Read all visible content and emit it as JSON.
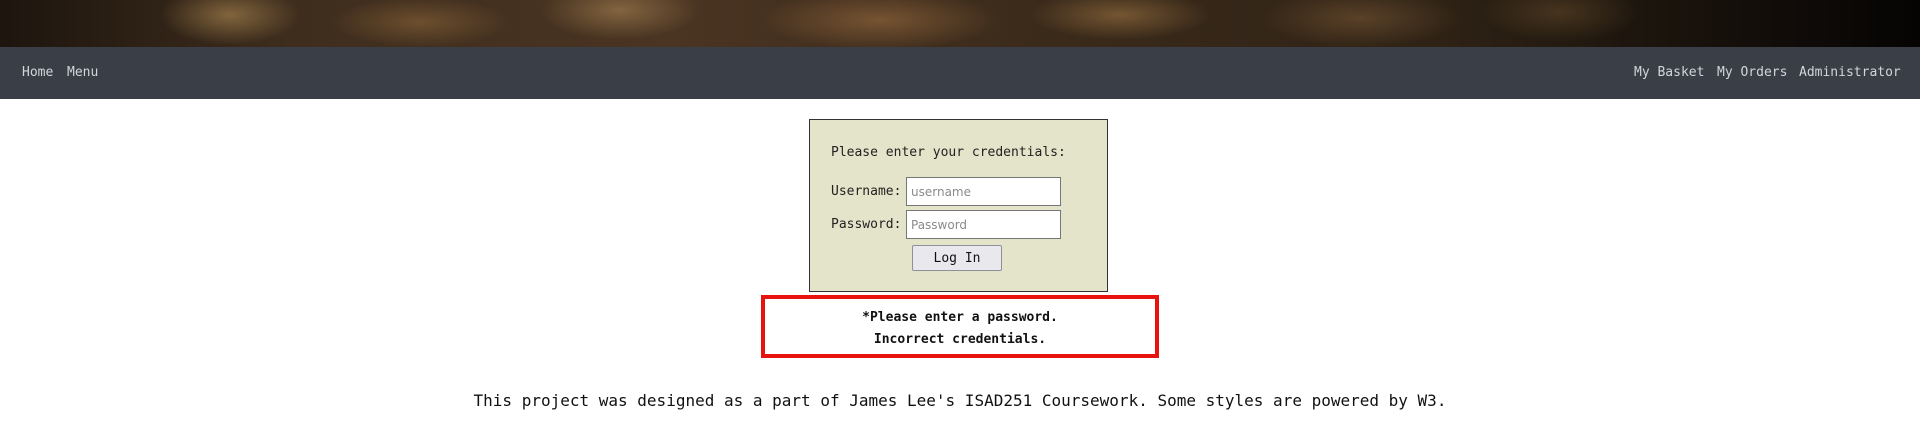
{
  "nav": {
    "left": [
      "Home",
      "Menu"
    ],
    "right": [
      "My Basket",
      "My Orders",
      "Administrator"
    ]
  },
  "login": {
    "prompt": "Please enter your credentials:",
    "username_label": "Username:",
    "username_placeholder": "username",
    "password_label": "Password:",
    "password_placeholder": "Password",
    "submit_label": "Log In"
  },
  "errors": [
    "*Please enter a password.",
    "Incorrect credentials."
  ],
  "footer": {
    "text": "This project was designed as a part of James Lee's ISAD251 Coursework. Some styles are powered by W3."
  },
  "colors": {
    "navbar": "#3a3f47",
    "login_box": "#e3e4c9",
    "error_border": "#e8120f"
  }
}
